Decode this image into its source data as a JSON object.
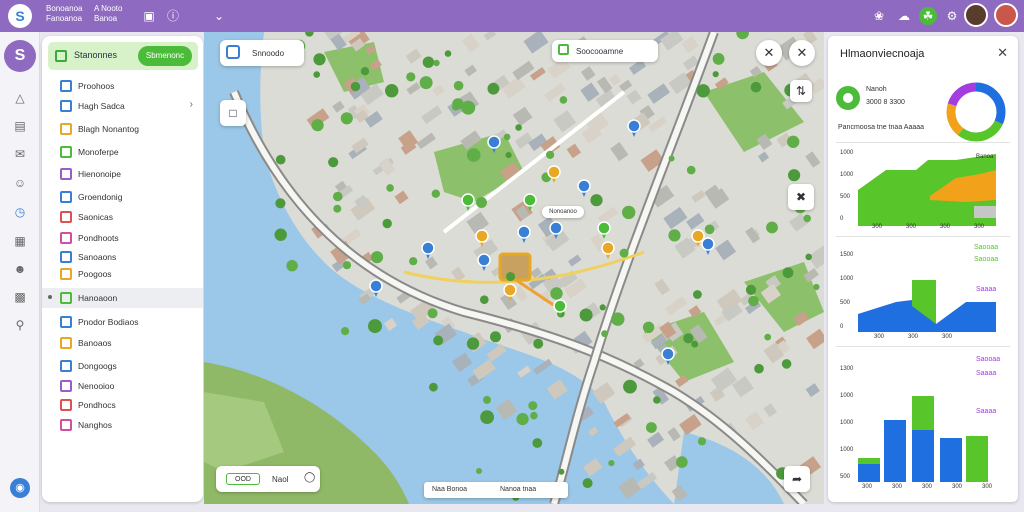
{
  "topbar": {
    "menu1_line1": "Bonoanoa",
    "menu1_line2": "Fanoanoa",
    "menu2_line1": "A Nooto",
    "menu2_line2": "Banoa"
  },
  "sidepanel": {
    "header_title": "Stanonnes",
    "header_button": "Sbmenonc",
    "items": [
      {
        "label": "Proohoos",
        "color": "#3a7fd6",
        "chevron": false
      },
      {
        "label": "Hagh Sadca",
        "color": "#3a7fd6",
        "chevron": true
      },
      {
        "label": "Blagh Nonantog",
        "color": "#e8a823",
        "chevron": false
      },
      {
        "label": "Monoferpe",
        "color": "#4cbb3a",
        "chevron": false
      },
      {
        "label": "Hienonoipe",
        "color": "#9c5cc8",
        "chevron": false
      },
      {
        "label": "Groendonig",
        "color": "#3a7fd6",
        "chevron": false
      },
      {
        "label": "Saonicas",
        "color": "#e05050",
        "chevron": false
      },
      {
        "label": "Pondhoots",
        "color": "#d04fa0",
        "chevron": false
      },
      {
        "label": "Sanoaons",
        "color": "#3a7fd6",
        "chevron": false
      },
      {
        "label": "Poogoos",
        "color": "#e8a823",
        "chevron": false
      },
      {
        "label": "Hanoaoon",
        "color": "#4cbb3a",
        "chevron": false,
        "active": true
      },
      {
        "label": "Pnodor Bodiaos",
        "color": "#3a7fd6",
        "chevron": false
      },
      {
        "label": "Banoaos",
        "color": "#e8a823",
        "chevron": false
      },
      {
        "label": "Dongoogs",
        "color": "#3a7fd6",
        "chevron": false
      },
      {
        "label": "Nenooioo",
        "color": "#9c5cc8",
        "chevron": false
      },
      {
        "label": "Pondhocs",
        "color": "#e05050",
        "chevron": false
      },
      {
        "label": "Nanghos",
        "color": "#d04fa0",
        "chevron": false
      }
    ]
  },
  "map": {
    "search_label": "Snnoodo",
    "top_chip": "Soocooamne",
    "bottom_left_chip": "OOD",
    "bottom_left_label": "Naol",
    "bottom_bar_left": "Naa Bonoa",
    "bottom_bar_right": "Nanoa tnaa",
    "popup_label": "Nonoanoo"
  },
  "rpanel": {
    "title": "Hlmaonviecnoaja",
    "stat_label": "Nanoh",
    "stat_value": "3000 8 3300",
    "stat_caption": "Pancmoosa tne  tnaa Aaaaa",
    "accent_blue": "#1f6fe0",
    "accent_green": "#58c52b",
    "accent_orange": "#f2a21a",
    "accent_purple": "#a43ce0",
    "chart1_ticks": [
      "1000",
      "1000",
      "500",
      "0"
    ],
    "chart1_x": [
      "300",
      "300",
      "300",
      "300"
    ],
    "chart1_legend": "Banoa",
    "chart2_ticks": [
      "1500",
      "1000",
      "500",
      "0"
    ],
    "chart2_x": [
      "300",
      "300",
      "300"
    ],
    "chart2_legend_top": "Saooaa",
    "chart2_legend_bottom": "Saooaa",
    "chart2_legend_mid": "Saaaa",
    "chart3_ticks": [
      "1300",
      "1000",
      "1000",
      "1000",
      "500"
    ],
    "chart3_x": [
      "300",
      "300",
      "300",
      "300",
      "300"
    ],
    "chart3_legend_top": "Saooaa",
    "chart3_legend_bottom": "Saaaa",
    "chart3_legend_mid": "Saaaa"
  }
}
